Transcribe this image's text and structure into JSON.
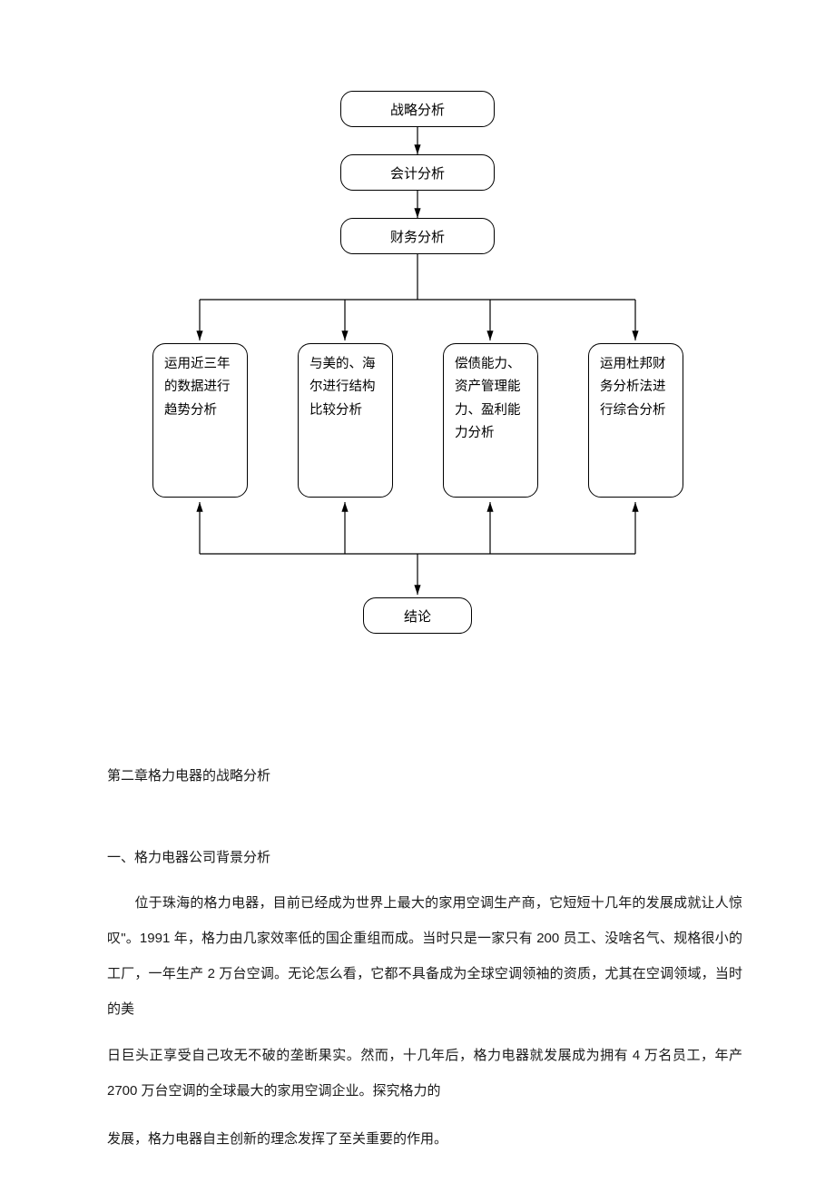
{
  "diagram": {
    "top1": "战略分析",
    "top2": "会计分析",
    "top3": "财务分析",
    "branch1": "运用近三年的数据进行趋势分析",
    "branch2": "与美的、海尔进行结构比较分析",
    "branch3": "偿债能力、资产管理能力、盈利能力分析",
    "branch4": "运用杜邦财务分析法进行综合分析",
    "conclusion": "结论"
  },
  "chapter_title": "第二章格力电器的战略分析",
  "section_title": "一、格力电器公司背景分析",
  "para1": "　　位于珠海的格力电器，目前已经成为世界上最大的家用空调生产商，它短短十几年的发展成就让人惊叹\"。1991 年，格力由几家效率低的国企重组而成。当时只是一家只有 200 员工、没啥名气、规格很小的工厂，一年生产 2 万台空调。无论怎么看，它都不具备成为全球空调领袖的资质，尤其在空调领域，当时的美",
  "para2": "日巨头正享受自己攻无不破的垄断果实。然而，十几年后，格力电器就发展成为拥有 4 万名员工，年产 2700 万台空调的全球最大的家用空调企业。探究格力的",
  "para3": "发展，格力电器自主创新的理念发挥了至关重要的作用。"
}
